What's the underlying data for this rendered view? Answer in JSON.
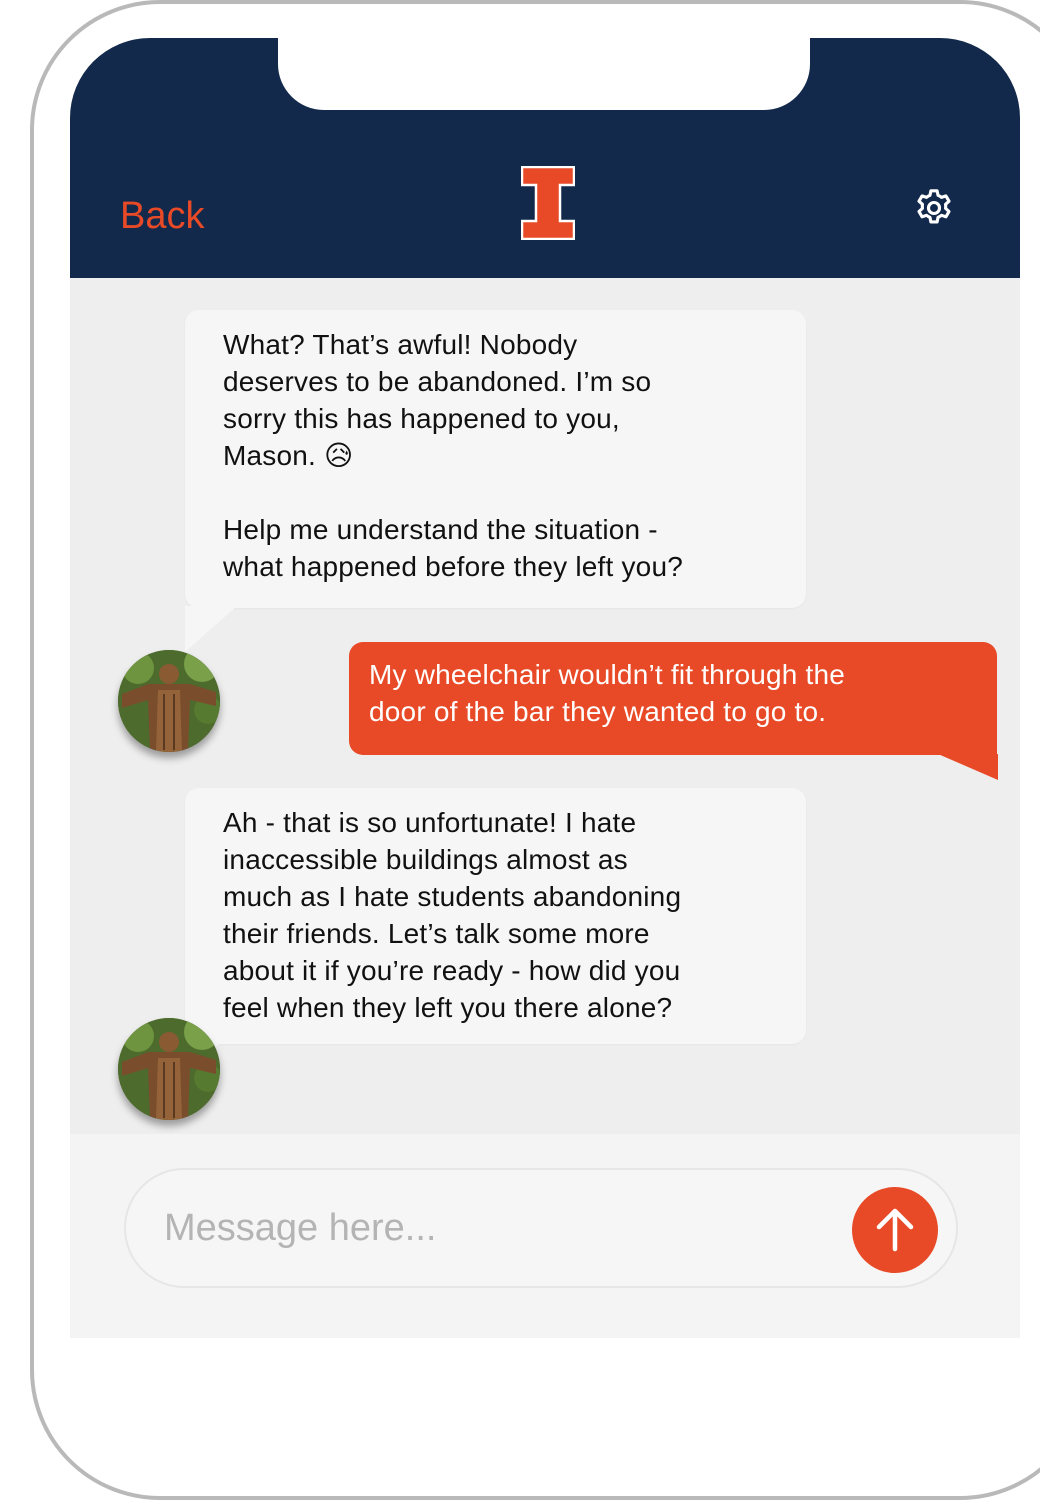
{
  "header": {
    "back_label": "Back",
    "logo_icon": "illinois-block-i-icon",
    "settings_icon": "gear-icon"
  },
  "messages": [
    {
      "sender": "assistant",
      "text": "What? That’s awful! Nobody\ndeserves to be abandoned. I’m so\nsorry this has happened to you,\nMason. 😥\n\nHelp me understand the situation -\nwhat happened before they left you?"
    },
    {
      "sender": "user",
      "text": "My wheelchair wouldn’t fit through the\ndoor of the bar they wanted to go to."
    },
    {
      "sender": "assistant",
      "text": "Ah - that is so unfortunate! I hate\ninaccessible buildings almost as\nmuch as I hate students abandoning\ntheir friends. Let’s talk some more\nabout it if you’re ready - how did you\nfeel when they left you there alone?"
    }
  ],
  "composer": {
    "placeholder": "Message here...",
    "value": "",
    "send_icon": "arrow-up-icon"
  },
  "colors": {
    "navy": "#13294b",
    "orange": "#e84a27",
    "incoming_bubble": "#f6f6f6",
    "chat_background": "#eeeeee"
  }
}
